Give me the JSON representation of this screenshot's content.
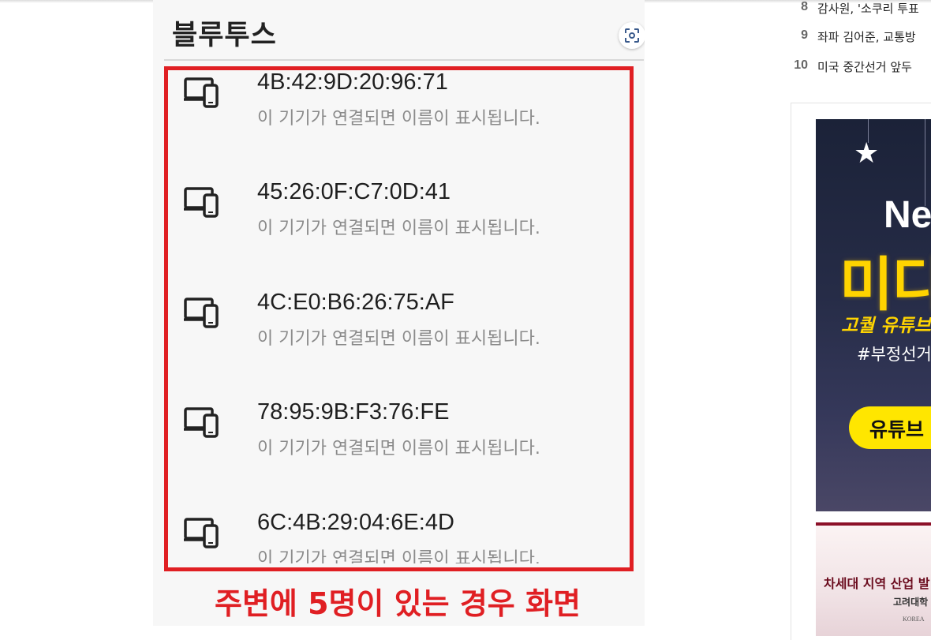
{
  "phone": {
    "title": "블루투스",
    "scan_icon": "scan-icon",
    "devices": [
      {
        "mac": "4B:42:9D:20:96:71",
        "note": "이 기기가 연결되면 이름이 표시됩니다.",
        "icon": "devices-icon"
      },
      {
        "mac": "45:26:0F:C7:0D:41",
        "note": "이 기기가 연결되면 이름이 표시됩니다.",
        "icon": "devices-icon"
      },
      {
        "mac": "4C:E0:B6:26:75:AF",
        "note": "이 기기가 연결되면 이름이 표시됩니다.",
        "icon": "devices-icon"
      },
      {
        "mac": "78:95:9B:F3:76:FE",
        "note": "이 기기가 연결되면 이름이 표시됩니다.",
        "icon": "devices-icon"
      },
      {
        "mac": "6C:4B:29:04:6E:4D",
        "note": "이 기기가 연결되면 이름이 표시됩니다.",
        "icon": "devices-icon"
      }
    ],
    "caption": "주변에 5명이 있는 경우 화면",
    "highlight_color": "#e01f23"
  },
  "sidebar": {
    "ranking": [
      {
        "num": "8",
        "text": "감사원, '소쿠리 투표"
      },
      {
        "num": "9",
        "text": "좌파 김어준, 교통방"
      },
      {
        "num": "10",
        "text": "미국 중간선거 앞두"
      }
    ],
    "ad1": {
      "big": "Ne",
      "headline": "미디",
      "sub1": "고퀄 유튜브",
      "sub2": "#부정선거",
      "button": "유튜브"
    },
    "ad2": {
      "line1": "차세대 지역 산업 발",
      "line2": "고려대학",
      "line3": "KOREA"
    }
  }
}
